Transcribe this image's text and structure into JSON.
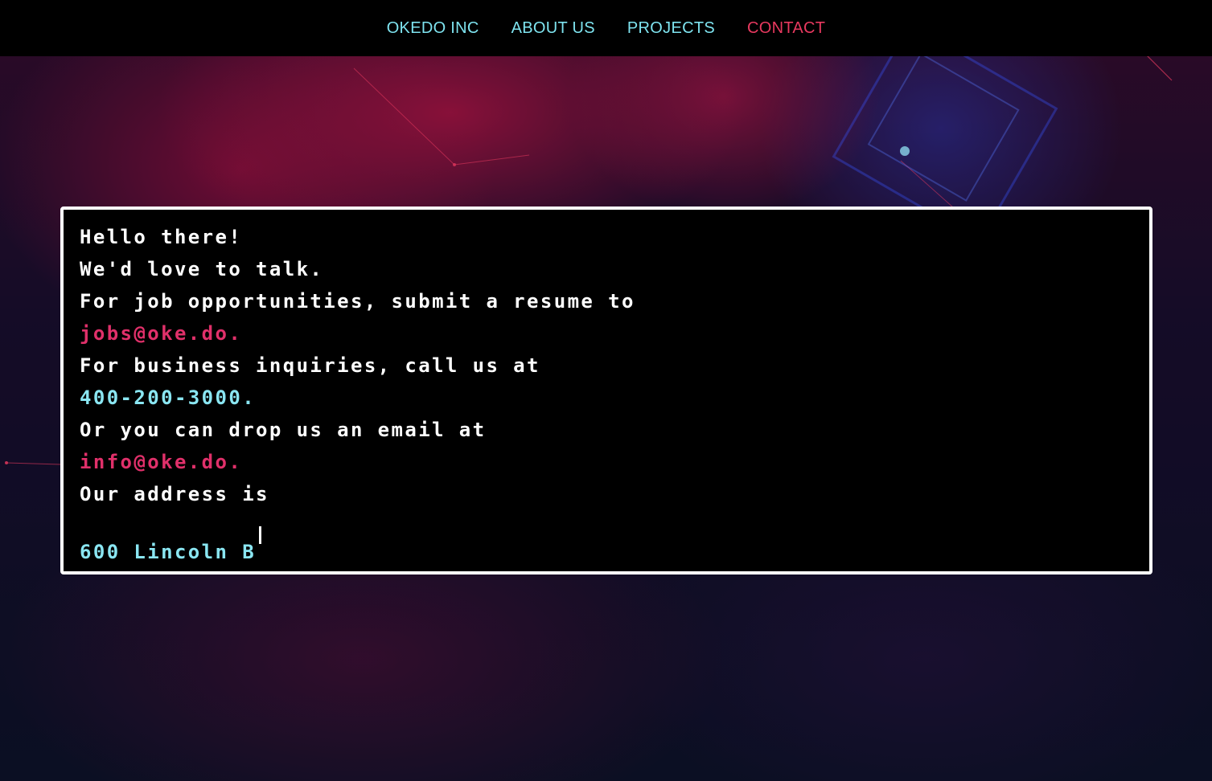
{
  "nav": {
    "items": [
      {
        "label": "OKEDO INC",
        "active": false
      },
      {
        "label": "ABOUT US",
        "active": false
      },
      {
        "label": "PROJECTS",
        "active": false
      },
      {
        "label": "CONTACT",
        "active": true
      }
    ]
  },
  "colors": {
    "nav_link": "#7ee3ef",
    "nav_active": "#e8395f",
    "email": "#e0306a",
    "phone_address": "#8ae6f2",
    "terminal_text": "#ffffff",
    "terminal_bg": "#000000"
  },
  "terminal": {
    "greeting": "Hello there!",
    "intro": "We'd love to talk.",
    "jobs_text": "For job opportunities, submit a resume to",
    "jobs_email": "jobs@oke.do.",
    "business_text": "For business inquiries, call us at",
    "phone": "400-200-3000.",
    "email_text": "Or you can drop us an email at",
    "info_email": "info@oke.do.",
    "address_text": "Our address is",
    "address_partial": "600 Lincoln B"
  }
}
